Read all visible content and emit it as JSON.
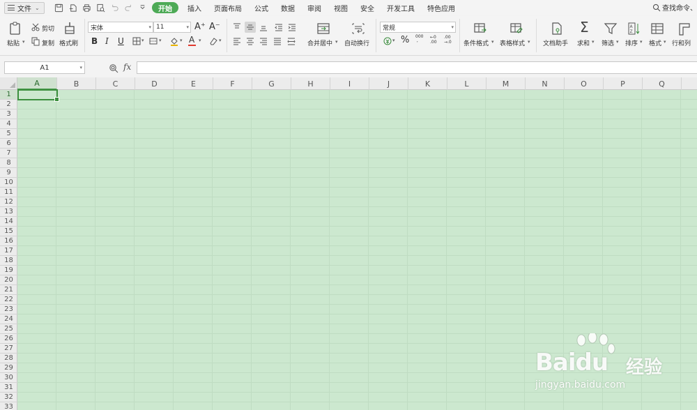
{
  "menubar": {
    "file_label": "文件",
    "tabs": [
      "开始",
      "插入",
      "页面布局",
      "公式",
      "数据",
      "审阅",
      "视图",
      "安全",
      "开发工具",
      "特色应用"
    ],
    "active_tab": "开始",
    "search_label": "查找命令、"
  },
  "ribbon": {
    "paste": "粘贴",
    "cut": "剪切",
    "copy": "复制",
    "format_painter": "格式刷",
    "font_name": "宋体",
    "font_size": "11",
    "merge_center": "合并居中",
    "wrap_text": "自动换行",
    "number_format": "常规",
    "conditional_format": "条件格式",
    "table_style": "表格样式",
    "doc_helper": "文档助手",
    "sum": "求和",
    "filter": "筛选",
    "sort": "排序",
    "format": "格式",
    "rows_cols": "行和列",
    "icons": [
      "paste-icon",
      "cut-icon",
      "copy-icon",
      "format-painter-icon",
      "bold-icon",
      "italic-icon",
      "underline-icon",
      "border-icon",
      "merge-cell-icon",
      "fill-color-icon",
      "font-color-icon",
      "clear-icon",
      "percent-icon",
      "sum-icon",
      "filter-icon",
      "sort-icon"
    ]
  },
  "formula_bar": {
    "name_box": "A1",
    "fx": "fx",
    "content": ""
  },
  "grid": {
    "columns": [
      "A",
      "B",
      "C",
      "D",
      "E",
      "F",
      "G",
      "H",
      "I",
      "J",
      "K",
      "L",
      "M",
      "N",
      "O",
      "P",
      "Q"
    ],
    "rows": [
      "1",
      "2",
      "3",
      "4",
      "5",
      "6",
      "7",
      "8",
      "9",
      "10",
      "11",
      "12",
      "13",
      "14",
      "15",
      "16",
      "17",
      "18",
      "19",
      "20",
      "21",
      "22",
      "23",
      "24",
      "25",
      "26",
      "27",
      "28",
      "29",
      "30",
      "31",
      "32",
      "33"
    ],
    "selected_cell": "A1",
    "background": "#cce8cf"
  },
  "watermark": {
    "brand": "Baidu",
    "cn": "经验",
    "url": "jingyan.baidu.com"
  }
}
